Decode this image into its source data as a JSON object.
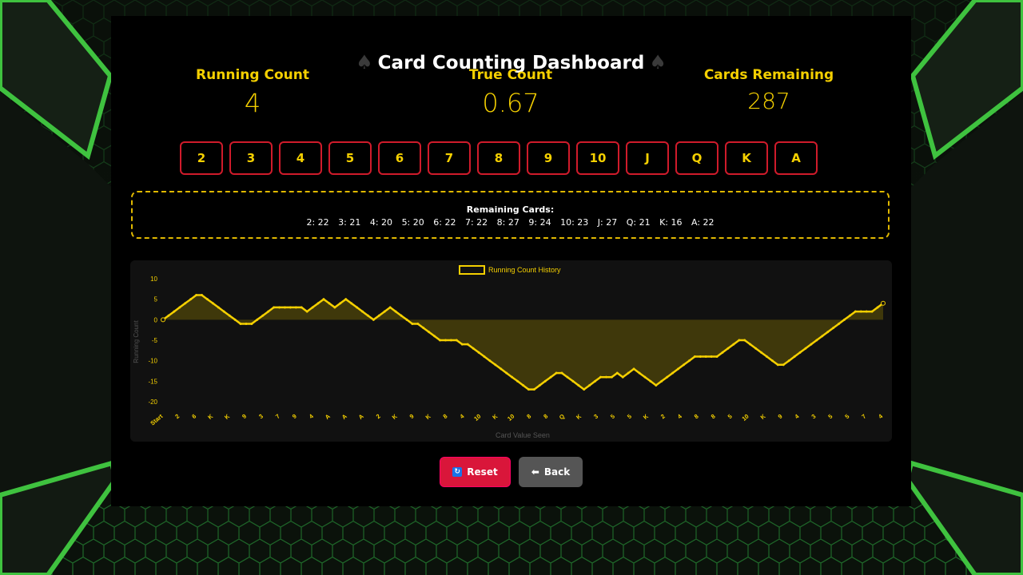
{
  "title": "Card Counting Dashboard",
  "stats": [
    {
      "label": "Running Count",
      "value": "4"
    },
    {
      "label": "True Count",
      "value": "0.67"
    },
    {
      "label": "Cards Remaining",
      "value": "287"
    }
  ],
  "card_buttons": [
    "2",
    "3",
    "4",
    "5",
    "6",
    "7",
    "8",
    "9",
    "10",
    "J",
    "Q",
    "K",
    "A"
  ],
  "remaining": {
    "title": "Remaining Cards:",
    "items": [
      "2: 22",
      "3: 21",
      "4: 20",
      "5: 20",
      "6: 22",
      "7: 22",
      "8: 27",
      "9: 24",
      "10: 23",
      "J: 27",
      "Q: 21",
      "K: 16",
      "A: 22"
    ]
  },
  "buttons": {
    "reset_label": "Reset",
    "back_label": "Back",
    "reset_icon": "refresh-icon",
    "back_icon": "arrow-left-icon"
  },
  "colors": {
    "accent": "#f5d000",
    "card_border": "#d01b2b",
    "reset_bg": "#d9163a",
    "back_bg": "#555555",
    "dashed_border": "#e0b800"
  },
  "chart_data": {
    "type": "line",
    "legend": "Running Count History",
    "legend_position": "top",
    "xlabel": "Card Value Seen",
    "ylabel": "Running Count",
    "yticks": [
      10,
      5,
      0,
      -5,
      -10,
      -15,
      -20
    ],
    "ylim": [
      -20,
      10
    ],
    "grid": false,
    "series": [
      {
        "name": "Running Count History",
        "values": [
          0,
          1,
          2,
          3,
          4,
          5,
          6,
          6,
          5,
          4,
          3,
          2,
          1,
          0,
          -1,
          -1,
          -1,
          0,
          1,
          2,
          3,
          3,
          3,
          3,
          3,
          3,
          2,
          3,
          4,
          5,
          4,
          3,
          4,
          5,
          4,
          3,
          2,
          1,
          0,
          1,
          2,
          3,
          2,
          1,
          0,
          -1,
          -1,
          -2,
          -3,
          -4,
          -5,
          -5,
          -5,
          -5,
          -6,
          -6,
          -7,
          -8,
          -9,
          -10,
          -11,
          -12,
          -13,
          -14,
          -15,
          -16,
          -17,
          -17,
          -16,
          -15,
          -14,
          -13,
          -13,
          -14,
          -15,
          -16,
          -17,
          -16,
          -15,
          -14,
          -14,
          -14,
          -13,
          -14,
          -13,
          -12,
          -13,
          -14,
          -15,
          -16,
          -15,
          -14,
          -13,
          -12,
          -11,
          -10,
          -9,
          -9,
          -9,
          -9,
          -9,
          -8,
          -7,
          -6,
          -5,
          -5,
          -6,
          -7,
          -8,
          -9,
          -10,
          -11,
          -11,
          -10,
          -9,
          -8,
          -7,
          -6,
          -5,
          -4,
          -3,
          -2,
          -1,
          0,
          1,
          2,
          2,
          2,
          2,
          3,
          4
        ]
      }
    ],
    "xtick_labels": [
      "Start",
      "2",
      "6",
      "K",
      "K",
      "9",
      "3",
      "7",
      "9",
      "4",
      "A",
      "A",
      "A",
      "2",
      "K",
      "9",
      "K",
      "8",
      "4",
      "10",
      "K",
      "10",
      "8",
      "8",
      "Q",
      "K",
      "3",
      "5",
      "5",
      "K",
      "2",
      "4",
      "8",
      "8",
      "5",
      "10",
      "K",
      "9",
      "4",
      "3",
      "5",
      "5",
      "7",
      "4"
    ]
  }
}
